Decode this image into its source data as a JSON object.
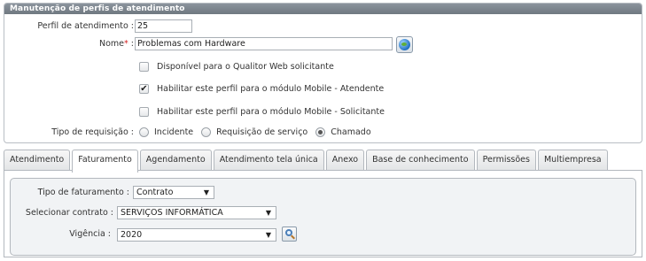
{
  "header": {
    "title": "Manutenção de perfis de atendimento"
  },
  "form": {
    "perfil_label": "Perfil de atendimento :",
    "perfil_value": "25",
    "nome_label": "Nome",
    "nome_required": "*",
    "nome_colon": " :",
    "nome_value": "Problemas com Hardware",
    "checkboxes": [
      {
        "label": "Disponível para o Qualitor Web solicitante",
        "checked": false
      },
      {
        "label": "Habilitar este perfil para o módulo Mobile - Atendente",
        "checked": true
      },
      {
        "label": "Habilitar este perfil para o módulo Mobile - Solicitante",
        "checked": false
      }
    ],
    "tipo_label": "Tipo de requisição :",
    "tipo_options": [
      "Incidente",
      "Requisição de serviço",
      "Chamado"
    ],
    "tipo_selected": "Chamado"
  },
  "tabs": [
    {
      "label": "Atendimento"
    },
    {
      "label": "Faturamento"
    },
    {
      "label": "Agendamento"
    },
    {
      "label": "Atendimento tela única"
    },
    {
      "label": "Anexo"
    },
    {
      "label": "Base de conhecimento"
    },
    {
      "label": "Permissões"
    },
    {
      "label": "Multiempresa"
    }
  ],
  "active_tab": "Faturamento",
  "faturamento": {
    "tipo_label": "Tipo de faturamento :",
    "tipo_value": "Contrato",
    "contrato_label": "Selecionar contrato :",
    "contrato_value": "SERVIÇOS INFORMÁTICA",
    "vigencia_label": "Vigência :",
    "vigencia_value": "2020"
  },
  "glyphs": {
    "check": "✔",
    "dropdown_arrow": "▼"
  },
  "icons": {
    "globe": "globe-icon",
    "search": "zoom-search-icon"
  }
}
